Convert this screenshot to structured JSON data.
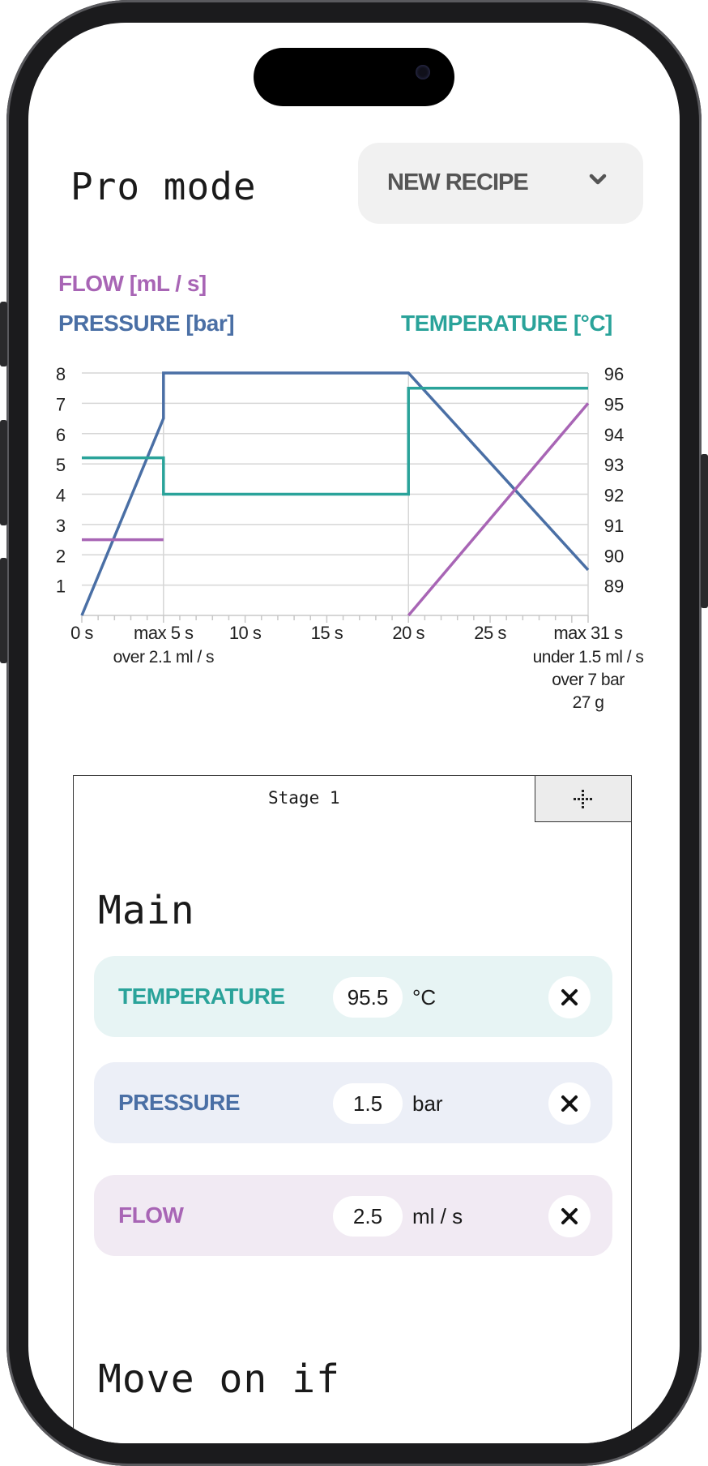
{
  "header": {
    "title": "Pro mode",
    "recipe_select": "NEW RECIPE"
  },
  "legend": {
    "flow": "FLOW [mL / s]",
    "pressure": "PRESSURE [bar]",
    "temperature": "TEMPERATURE [°C]"
  },
  "colors": {
    "flow": "#a865b5",
    "pressure": "#4a6fa5",
    "temperature": "#2aa39a",
    "temperature_bg": "#e7f4f4",
    "pressure_bg": "#eceff7",
    "flow_bg": "#f1eaf3"
  },
  "chart_data": {
    "type": "line",
    "x_ticks": [
      "0 s",
      "max 5 s",
      "10 s",
      "15 s",
      "20 s",
      "25 s",
      "max 31 s"
    ],
    "x_tick_values": [
      0,
      5,
      10,
      15,
      20,
      25,
      31
    ],
    "xlim": [
      0,
      31
    ],
    "left_axis": {
      "label": "PRESSURE [bar] / FLOW [mL / s]",
      "ticks": [
        1,
        2,
        3,
        4,
        5,
        6,
        7,
        8
      ],
      "ylim": [
        0,
        8
      ]
    },
    "right_axis": {
      "label": "TEMPERATURE [°C]",
      "ticks": [
        89,
        90,
        91,
        92,
        93,
        94,
        95,
        96
      ],
      "ylim": [
        88,
        96
      ]
    },
    "x_annotations": [
      {
        "at": 5,
        "lines": [
          "over 2.1 ml / s"
        ]
      },
      {
        "at": 31,
        "lines": [
          "under 1.5 ml / s",
          "over 7 bar",
          "27 g"
        ]
      }
    ],
    "series": [
      {
        "name": "PRESSURE [bar]",
        "axis": "left",
        "x": [
          0,
          5,
          5,
          20,
          31
        ],
        "y": [
          0,
          6.5,
          8,
          8,
          1.5
        ]
      },
      {
        "name": "FLOW [mL / s]",
        "axis": "left",
        "segments": [
          {
            "x": [
              0,
              5
            ],
            "y": [
              2.5,
              2.5
            ]
          },
          {
            "x": [
              20,
              31
            ],
            "y": [
              0,
              7
            ]
          }
        ]
      },
      {
        "name": "TEMPERATURE [°C]",
        "axis": "right",
        "x": [
          0,
          5,
          5,
          20,
          20,
          31
        ],
        "y": [
          93.2,
          93.2,
          92,
          92,
          95.5,
          95.5
        ]
      }
    ],
    "grid": true
  },
  "stage": {
    "label": "Stage 1",
    "main_title": "Main",
    "params": [
      {
        "name": "TEMPERATURE",
        "value": "95.5",
        "unit": "°C"
      },
      {
        "name": "PRESSURE",
        "value": "1.5",
        "unit": "bar"
      },
      {
        "name": "FLOW",
        "value": "2.5",
        "unit": "ml / s"
      }
    ],
    "move_on_title": "Move on if"
  }
}
